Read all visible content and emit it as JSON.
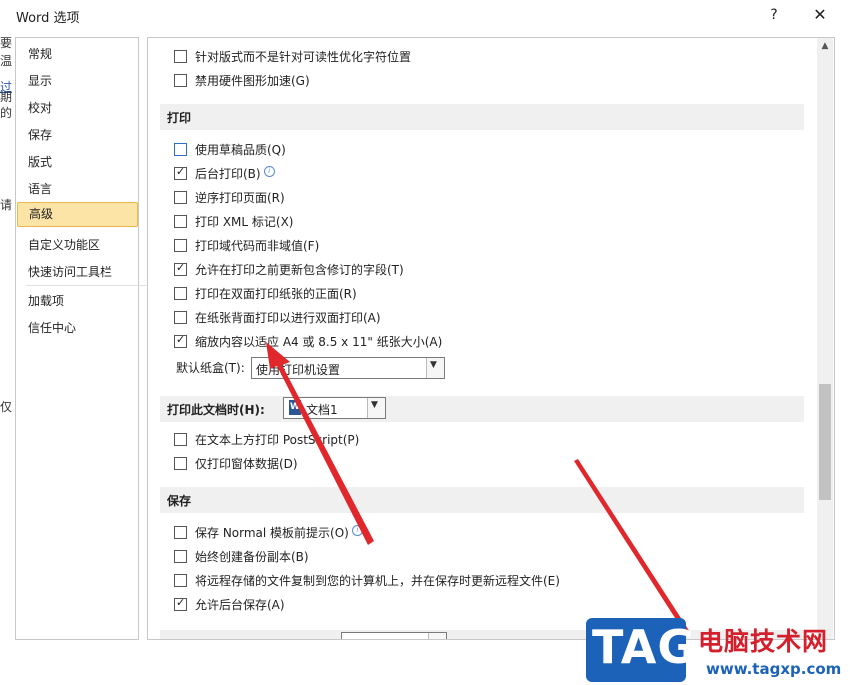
{
  "window": {
    "title": "Word 选项",
    "help_label": "?",
    "close_label": "✕"
  },
  "left_edge_chars": [
    "要",
    "温",
    "过",
    "期",
    "的",
    "请",
    "仅"
  ],
  "nav": {
    "items": [
      {
        "label": "常规",
        "selected": false
      },
      {
        "label": "显示",
        "selected": false
      },
      {
        "label": "校对",
        "selected": false
      },
      {
        "label": "保存",
        "selected": false
      },
      {
        "label": "版式",
        "selected": false
      },
      {
        "label": "语言",
        "selected": false
      },
      {
        "label": "高级",
        "selected": true
      },
      {
        "label": "自定义功能区",
        "selected": false
      },
      {
        "label": "快速访问工具栏",
        "selected": false
      },
      {
        "label": "加载项",
        "selected": false
      },
      {
        "label": "信任中心",
        "selected": false
      }
    ]
  },
  "options_top": [
    {
      "label": "针对版式而不是针对可读性优化字符位置",
      "checked": false
    },
    {
      "label": "禁用硬件图形加速(G)",
      "checked": false
    }
  ],
  "print_section": {
    "title": "打印",
    "options": [
      {
        "label": "使用草稿品质(Q)",
        "checked": false,
        "info": false
      },
      {
        "label": "后台打印(B)",
        "checked": true,
        "info": true
      },
      {
        "label": "逆序打印页面(R)",
        "checked": false,
        "info": false
      },
      {
        "label": "打印 XML 标记(X)",
        "checked": false,
        "info": false
      },
      {
        "label": "打印域代码而非域值(F)",
        "checked": false,
        "info": false
      },
      {
        "label": "允许在打印之前更新包含修订的字段(T)",
        "checked": true,
        "info": false
      },
      {
        "label": "打印在双面打印纸张的正面(R)",
        "checked": false,
        "info": false
      },
      {
        "label": "在纸张背面打印以进行双面打印(A)",
        "checked": false,
        "info": false
      },
      {
        "label": "缩放内容以适应 A4 或 8.5 x 11\" 纸张大小(A)",
        "checked": true,
        "info": false
      }
    ],
    "tray_label": "默认纸盒(T):",
    "tray_value": "使用打印机设置"
  },
  "print_doc_section": {
    "title": "打印此文档时(H):",
    "doc_value": "文档1",
    "doc_icon": "word-doc-icon",
    "options": [
      {
        "label": "在文本上方打印 PostScript(P)",
        "checked": false
      },
      {
        "label": "仅打印窗体数据(D)",
        "checked": false
      }
    ]
  },
  "save_section": {
    "title": "保存",
    "options": [
      {
        "label": "保存 Normal 模板前提示(O)",
        "checked": false,
        "info": true
      },
      {
        "label": "始终创建备份副本(B)",
        "checked": false,
        "info": false
      },
      {
        "label": "将远程存储的文件复制到您的计算机上，并在保存时更新远程文件(E)",
        "checked": false,
        "info": false
      },
      {
        "label": "允许后台保存(A)",
        "checked": true,
        "info": false
      }
    ]
  },
  "watermark": {
    "tag": "TAG",
    "cn": "电脑技术网",
    "url": "www.tagxp.com"
  },
  "colors": {
    "accent_selected": "#fce4a6",
    "arrow": "#e0282c",
    "watermark_blue": "#1c62b8"
  }
}
